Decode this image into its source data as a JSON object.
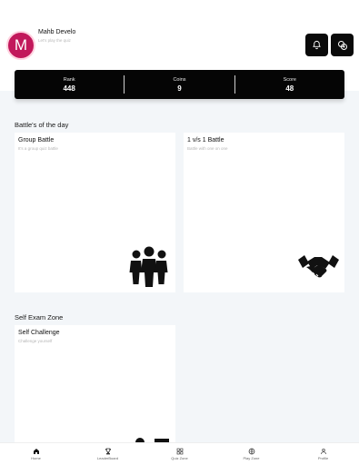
{
  "header": {
    "avatar_letter": "M",
    "user_name": "Mahb Develo",
    "user_subtitle": "Let's play the quiz",
    "notification_icon": "bell-icon",
    "coins_icon": "coins-icon"
  },
  "stats": [
    {
      "label": "Rank",
      "value": "448"
    },
    {
      "label": "Coins",
      "value": "9"
    },
    {
      "label": "Score",
      "value": "48"
    }
  ],
  "battles": {
    "section_title": "Battle's of the day",
    "cards": [
      {
        "title": "Group Battle",
        "subtitle": "It's a group quiz battle",
        "icon": "group-people-icon"
      },
      {
        "title": "1 v/s 1 Battle",
        "subtitle": "Battle with one on one",
        "icon": "handshake-icon"
      }
    ]
  },
  "self_exam": {
    "section_title": "Self Exam Zone",
    "cards": [
      {
        "title": "Self Challenge",
        "subtitle": "Challenge yourself",
        "icon": "self-challenge-icon"
      }
    ]
  },
  "bottom_nav": [
    {
      "label": "Home",
      "icon": "home-icon",
      "active": true
    },
    {
      "label": "LeaderBoard",
      "icon": "trophy-icon",
      "active": false
    },
    {
      "label": "Quiz Zone",
      "icon": "grid-icon",
      "active": false
    },
    {
      "label": "Play Zone",
      "icon": "globe-icon",
      "active": false
    },
    {
      "label": "Profile",
      "icon": "person-icon",
      "active": false
    }
  ],
  "colors": {
    "accent": "#000000",
    "avatar": "#c2185b",
    "background": "#f3f6f9"
  }
}
